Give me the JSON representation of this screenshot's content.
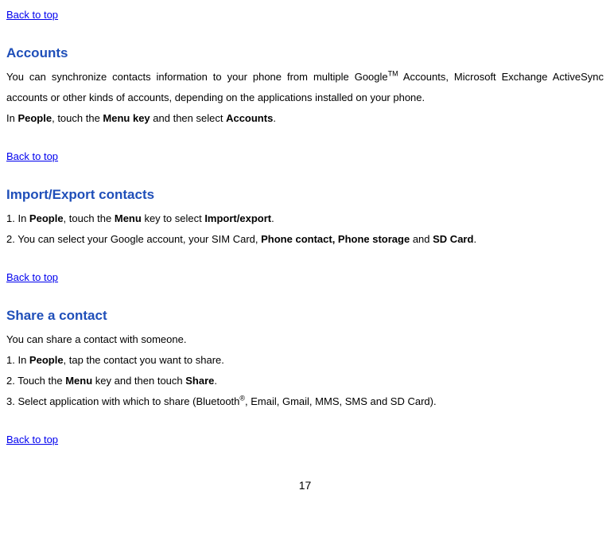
{
  "links": {
    "back_to_top": "Back to top"
  },
  "sections": {
    "accounts": {
      "heading": "Accounts",
      "p1_a": "You can synchronize contacts information to your phone from multiple Google",
      "p1_sup": "TM",
      "p1_b": " Accounts, Microsoft Exchange ActiveSync accounts or other kinds of accounts, depending on the applications installed on your phone.",
      "p2_a": "In ",
      "p2_b": "People",
      "p2_c": ", touch the ",
      "p2_d": "Menu key",
      "p2_e": " and then select ",
      "p2_f": "Accounts",
      "p2_g": "."
    },
    "import_export": {
      "heading": "Import/Export contacts",
      "p1_a": "1. In ",
      "p1_b": "People",
      "p1_c": ", touch the ",
      "p1_d": "Menu",
      "p1_e": " key to select ",
      "p1_f": "Import/export",
      "p1_g": ".",
      "p2_a": "2. You can select your Google account, your SIM Card, ",
      "p2_b": "Phone contact, Phone storage",
      "p2_c": " and ",
      "p2_d": "SD Card",
      "p2_e": "."
    },
    "share": {
      "heading": "Share a contact",
      "p1": "You can share a contact with someone.",
      "p2_a": "1. In ",
      "p2_b": "People",
      "p2_c": ", tap the contact you want to share.",
      "p3_a": "2. Touch the ",
      "p3_b": "Menu",
      "p3_c": " key and then touch ",
      "p3_d": "Share",
      "p3_e": ".",
      "p4_a": "3. Select application with which to share (Bluetooth",
      "p4_sup": "®",
      "p4_b": ", Email, Gmail, MMS, SMS and SD Card)."
    }
  },
  "page_number": "17"
}
